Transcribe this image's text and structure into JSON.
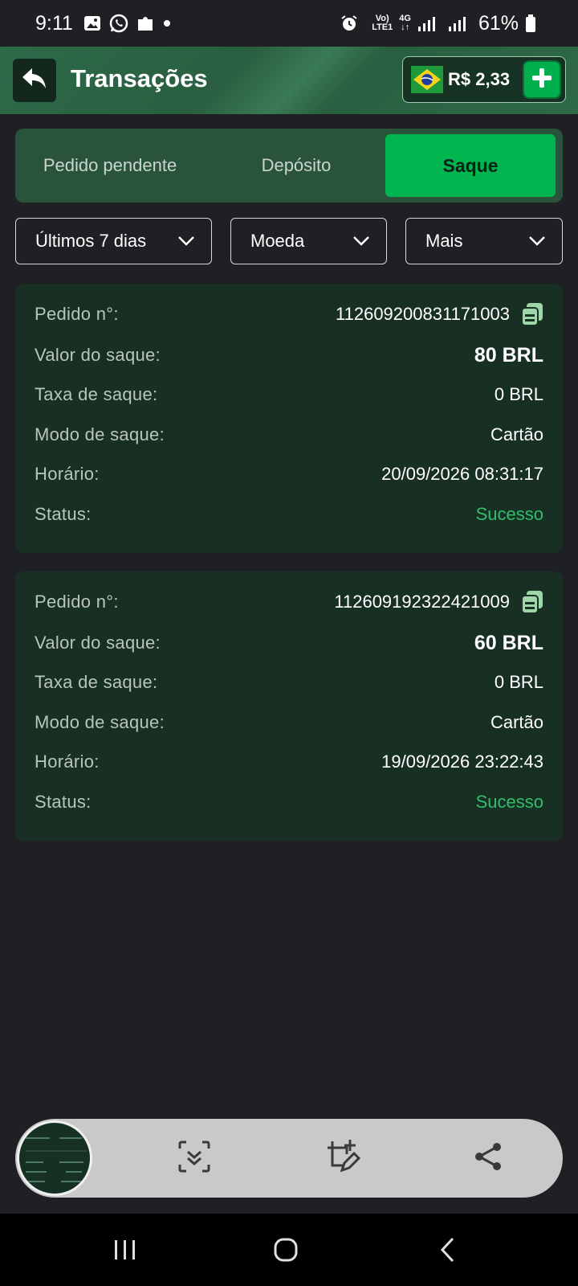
{
  "status_bar": {
    "time": "9:11",
    "network_top": "Vo)",
    "network_bottom": "LTE1",
    "gen": "4G",
    "battery": "61%"
  },
  "header": {
    "title": "Transações",
    "balance": "R$ 2,33"
  },
  "tabs": [
    {
      "label": "Pedido pendente",
      "active": false
    },
    {
      "label": "Depósito",
      "active": false
    },
    {
      "label": "Saque",
      "active": true
    }
  ],
  "filters": {
    "period": "Últimos 7 dias",
    "currency": "Moeda",
    "more": "Mais"
  },
  "labels": {
    "order_no": "Pedido n°:",
    "amount": "Valor do saque:",
    "fee": "Taxa de saque:",
    "mode": "Modo de saque:",
    "time": "Horário:",
    "status": "Status:"
  },
  "transactions": [
    {
      "order_no": "112609200831171003",
      "amount": "80 BRL",
      "fee": "0 BRL",
      "mode": "Cartão",
      "time": "20/09/2026 08:31:17",
      "status": "Sucesso"
    },
    {
      "order_no": "112609192322421009",
      "amount": "60 BRL",
      "fee": "0 BRL",
      "mode": "Cartão",
      "time": "19/09/2026 23:22:43",
      "status": "Sucesso"
    }
  ],
  "colors": {
    "accent": "#00b550",
    "success": "#2fbf6c",
    "card_bg": "#183024",
    "background": "#1f2024"
  },
  "icons": {
    "back": "back-arrow-icon",
    "add": "plus-icon",
    "copy": "copy-icon",
    "flag": "brazil-flag-icon",
    "scan": "scroll-capture-icon",
    "edit": "crop-edit-icon",
    "share": "share-icon"
  }
}
